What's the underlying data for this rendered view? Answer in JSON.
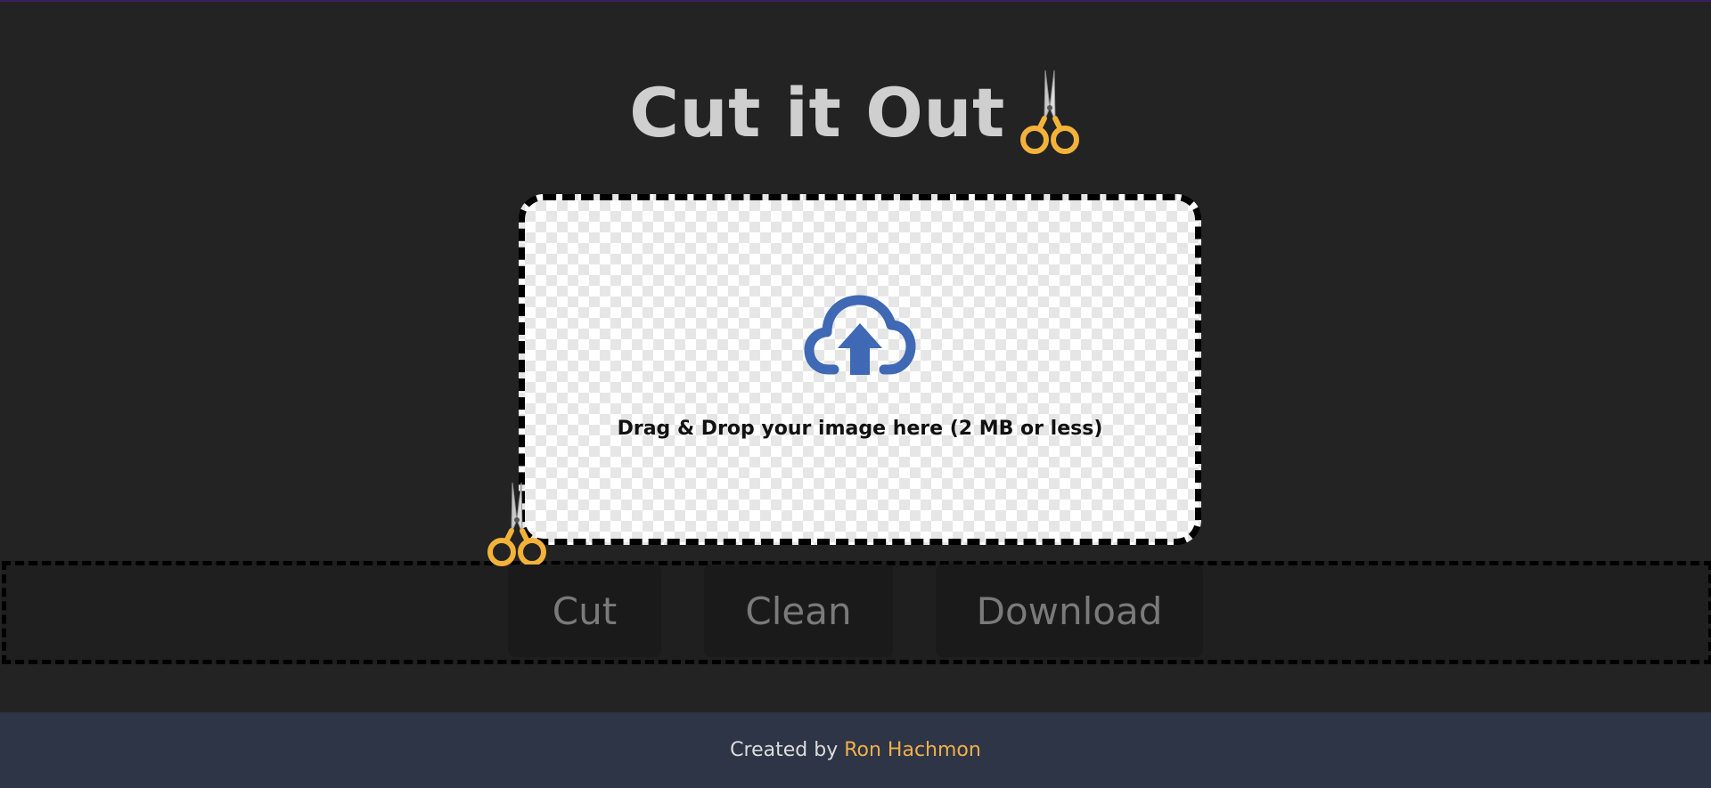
{
  "header": {
    "title": "Cut it Out",
    "title_icon": "scissors-icon"
  },
  "dropzone": {
    "icon": "cloud-upload-icon",
    "text": "Drag & Drop your image here (2 MB or less)"
  },
  "actions": {
    "cut_label": "Cut",
    "clean_label": "Clean",
    "download_label": "Download",
    "strip_icon": "scissors-icon"
  },
  "footer": {
    "prefix": "Created by",
    "author": "Ron Hachmon"
  },
  "colors": {
    "background": "#232323",
    "title": "#cfcfcf",
    "upload_icon": "#3f68b5",
    "scissors_handle": "#f3b23a",
    "footer_background": "#2e3547",
    "footer_link": "#f0b04a",
    "button_background": "#1a1a1a",
    "button_text": "#7a7a7a"
  }
}
